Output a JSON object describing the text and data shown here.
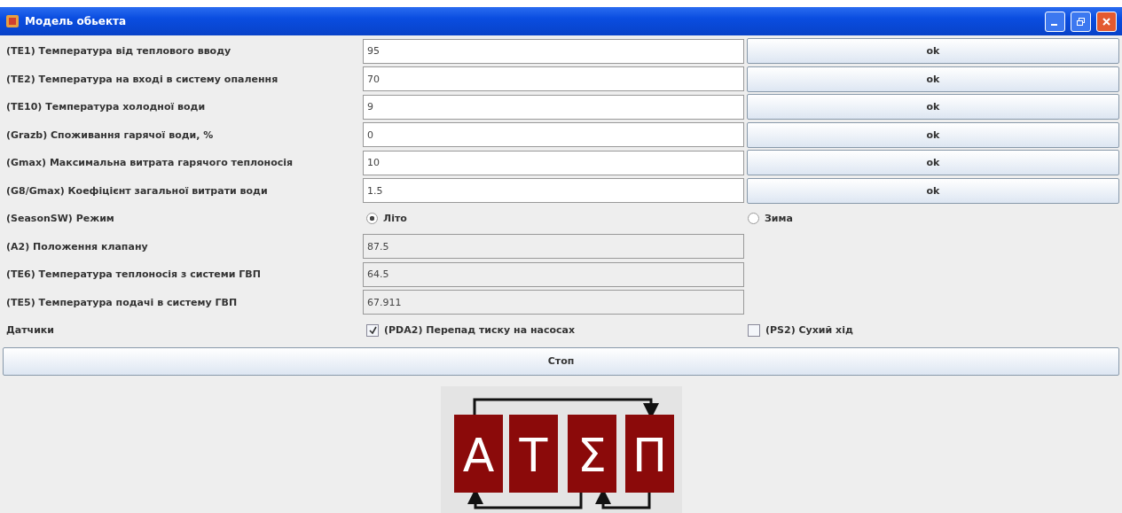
{
  "window": {
    "title": "Модель обьекта"
  },
  "rows": [
    {
      "kind": "input",
      "label": "(TE1) Температура від теплового вводу",
      "value": "95",
      "button": "ok"
    },
    {
      "kind": "input",
      "label": "(TE2) Температура на вході в систему опалення",
      "value": "70",
      "button": "ok"
    },
    {
      "kind": "input",
      "label": "(TE10) Температура холодної води",
      "value": "9",
      "button": "ok"
    },
    {
      "kind": "input",
      "label": "(Grazb) Споживання гарячої води, %",
      "value": "0",
      "button": "ok"
    },
    {
      "kind": "input",
      "label": "(Gmax) Максимальна витрата гарячого теплоносія",
      "value": "10",
      "button": "ok"
    },
    {
      "kind": "input",
      "label": "(G8/Gmax) Коефіцієнт загальної витрати води",
      "value": "1.5",
      "button": "ok"
    },
    {
      "kind": "radio",
      "label": "(SeasonSW) Режим",
      "options": [
        {
          "label": "Літо",
          "selected": true
        },
        {
          "label": "Зима",
          "selected": false
        }
      ]
    },
    {
      "kind": "readonly",
      "label": "(A2) Положення клапану",
      "value": "87.5"
    },
    {
      "kind": "readonly",
      "label": "(TE6) Температура теплоносія з системи ГВП",
      "value": "64.5"
    },
    {
      "kind": "readonly",
      "label": "(TE5) Температура подачі в систему ГВП",
      "value": "67.911"
    },
    {
      "kind": "checkbox",
      "label": "Датчики",
      "options": [
        {
          "label": "(PDA2) Перепад тиску на насосах",
          "checked": true
        },
        {
          "label": "(PS2) Сухий хід",
          "checked": false
        }
      ]
    }
  ],
  "stop_button": "Стоп",
  "logo": {
    "letters": [
      "А",
      "Т",
      "Σ",
      "П"
    ]
  }
}
